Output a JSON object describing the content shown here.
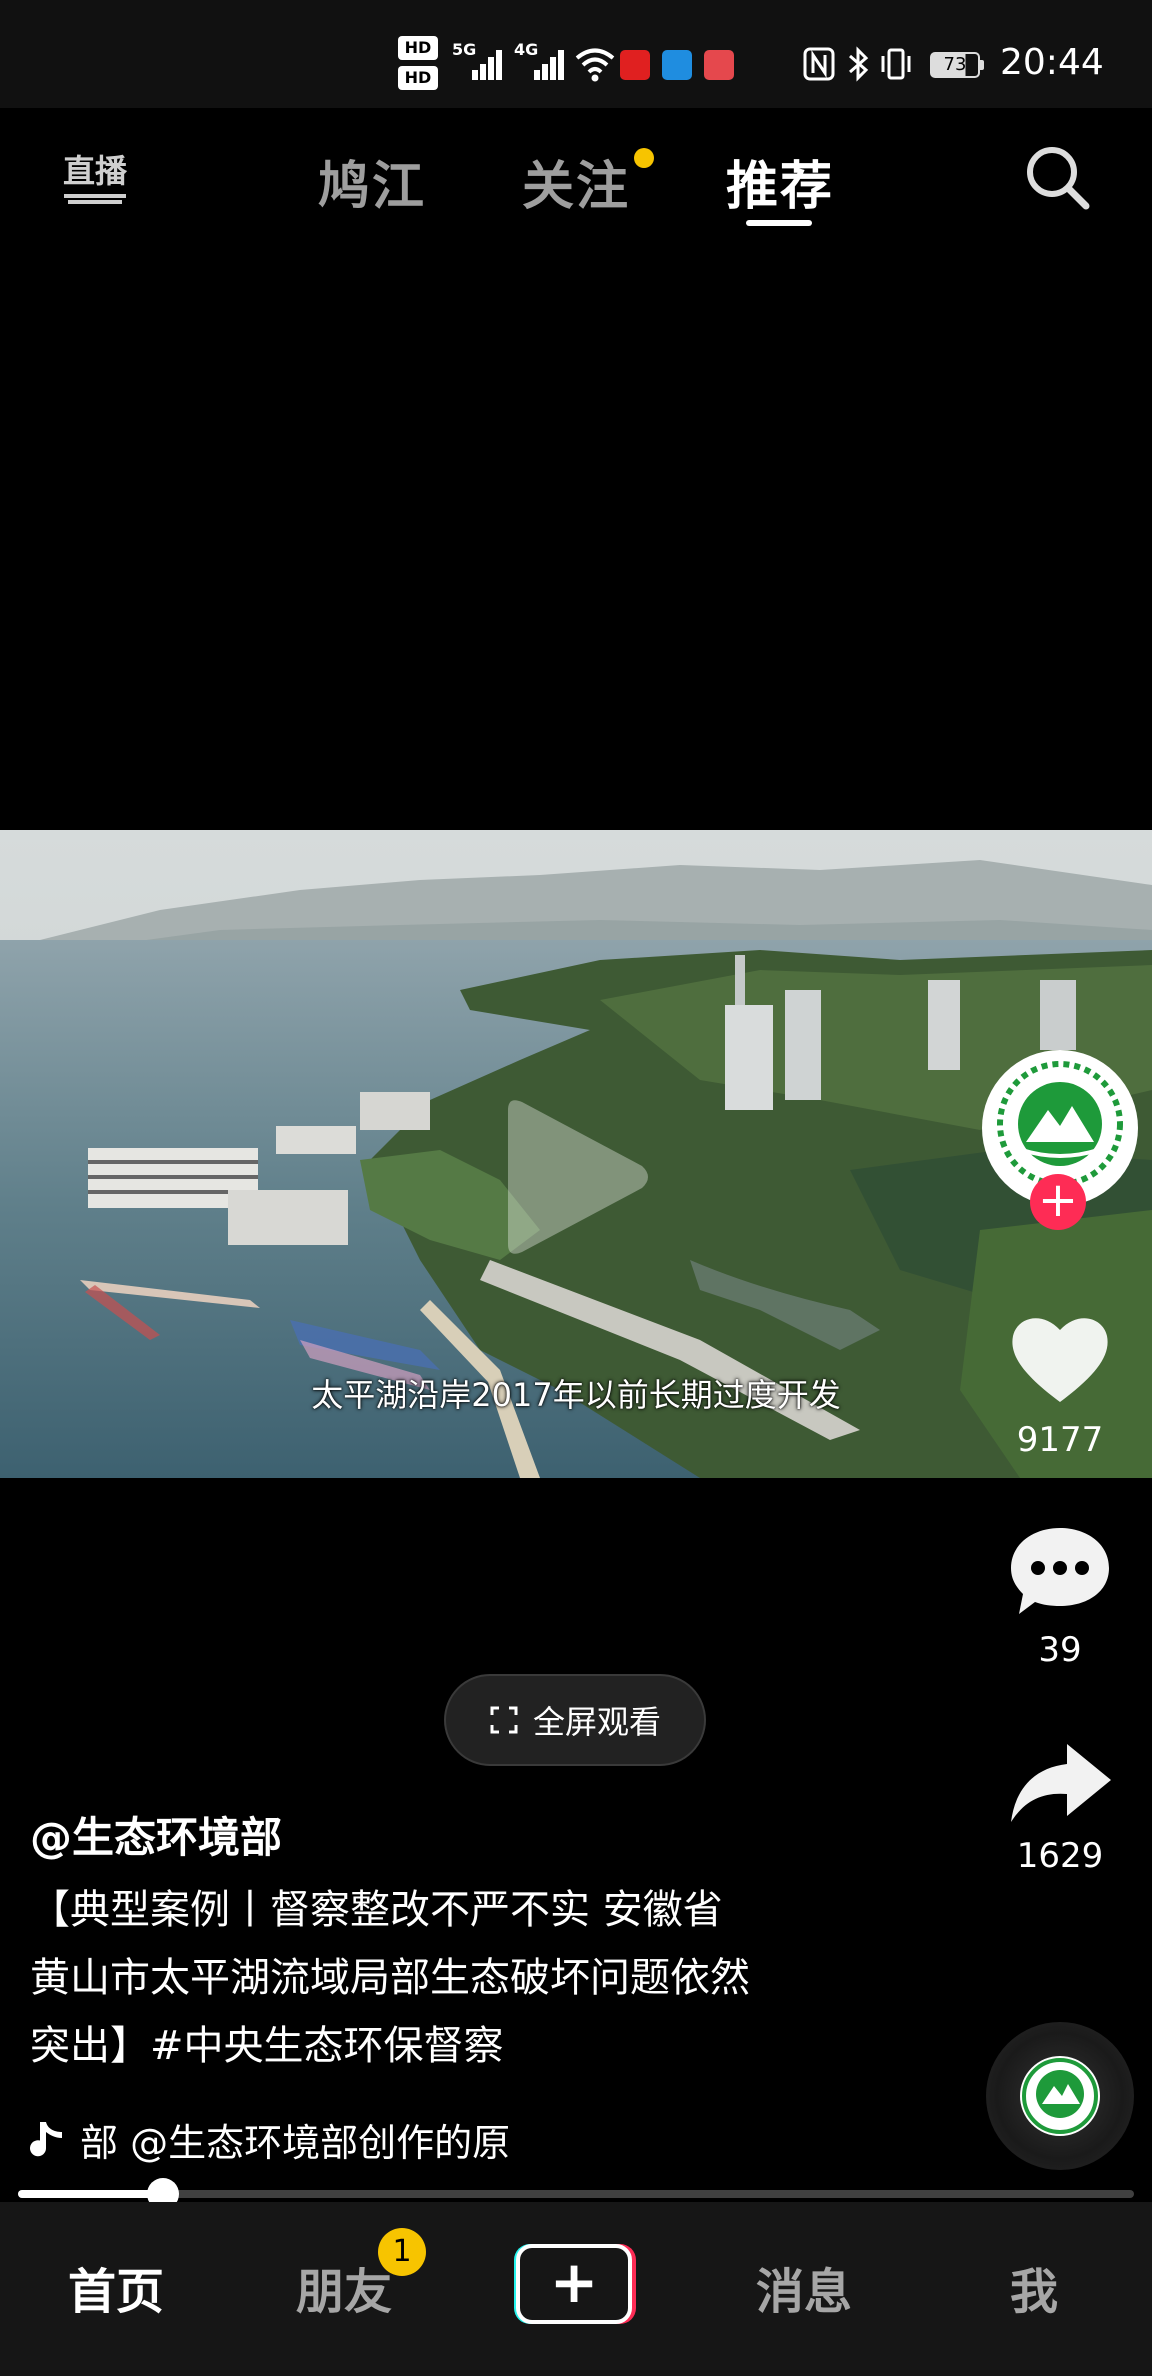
{
  "status_bar": {
    "hd1": "HD",
    "hd2": "HD",
    "net1": "5G",
    "net2": "4G",
    "battery": "73",
    "time": "20:44"
  },
  "top_nav": {
    "live_label": "直播",
    "tabs": [
      {
        "label": "鸠江",
        "active": false
      },
      {
        "label": "关注",
        "active": false,
        "has_dot": true
      },
      {
        "label": "推荐",
        "active": true
      }
    ]
  },
  "video": {
    "subtitle": "太平湖沿岸2017年以前长期过度开发"
  },
  "actions": {
    "likes": "9177",
    "comments": "39",
    "shares": "1629",
    "follow_plus": "+"
  },
  "fullscreen_label": "全屏观看",
  "post": {
    "author": "@生态环境部",
    "description_lines": [
      "【典型案例丨督察整改不严不实 安徽省",
      "黄山市太平湖流域局部生态破坏问题依然",
      "突出】#中央生态环保督察"
    ],
    "music": "部    @生态环境部创作的原"
  },
  "progress": {
    "fraction": 0.13
  },
  "bottom_tabs": {
    "home": "首页",
    "friends": "朋友",
    "friends_badge": "1",
    "create": "+",
    "messages": "消息",
    "me": "我"
  },
  "colors": {
    "accent_red": "#fe2c55",
    "badge_yellow": "#f7c400",
    "logo_green": "#1e9a3a"
  }
}
